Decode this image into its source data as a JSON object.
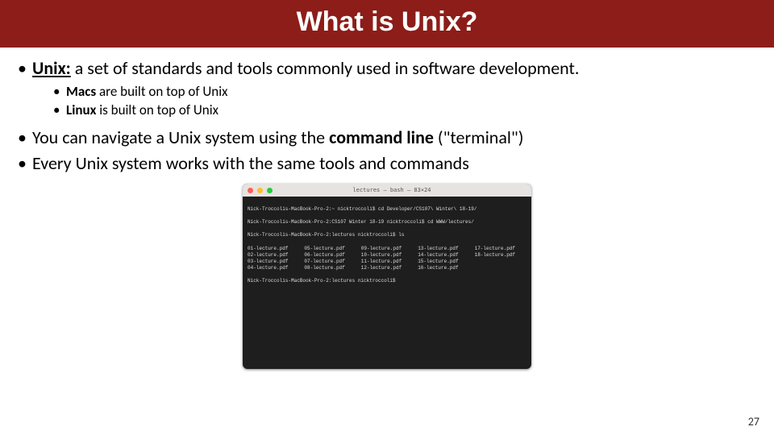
{
  "header": {
    "title": "What is Unix?"
  },
  "bullets": {
    "l1_unix_bold": "Unix:",
    "l1_unix_rest": " a set of standards and tools commonly used in software development.",
    "l2_macs_bold": "Macs",
    "l2_macs_rest": " are built on top of Unix",
    "l2_linux_bold": "Linux",
    "l2_linux_rest": " is built on top of Unix",
    "l1_nav_pre": "You can navigate a Unix system using the ",
    "l1_nav_bold": "command line",
    "l1_nav_post": " (\"terminal\")",
    "l1_every": "Every Unix system works with the same tools and commands"
  },
  "terminal": {
    "title": "lectures — bash — 83×24",
    "lines": [
      "Nick-Troccolis-MacBook-Pro-2:~ nicktroccoli$ cd Developer/CS107\\ Winter\\ 18-19/",
      "Nick-Troccolis-MacBook-Pro-2:CS107 Winter 18-19 nicktroccoli$ cd WWW/lectures/",
      "Nick-Troccolis-MacBook-Pro-2:lectures nicktroccoli$ ls"
    ],
    "ls_files": [
      "01-lecture.pdf",
      "05-lecture.pdf",
      "09-lecture.pdf",
      "13-lecture.pdf",
      "17-lecture.pdf",
      "02-lecture.pdf",
      "06-lecture.pdf",
      "10-lecture.pdf",
      "14-lecture.pdf",
      "18-lecture.pdf",
      "03-lecture.pdf",
      "07-lecture.pdf",
      "11-lecture.pdf",
      "15-lecture.pdf",
      "",
      "04-lecture.pdf",
      "08-lecture.pdf",
      "12-lecture.pdf",
      "16-lecture.pdf",
      ""
    ],
    "prompt_after": "Nick-Troccolis-MacBook-Pro-2:lectures nicktroccoli$ "
  },
  "page_number": "27"
}
